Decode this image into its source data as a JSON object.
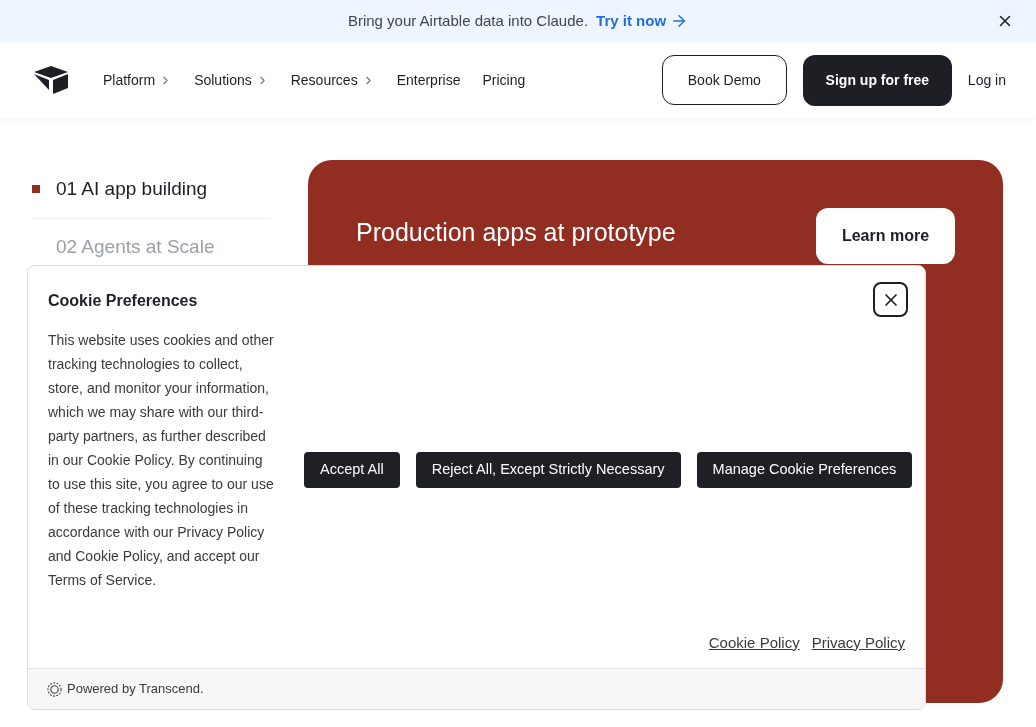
{
  "banner": {
    "text": "Bring your Airtable data into Claude.",
    "link": "Try it now"
  },
  "nav": {
    "items": [
      {
        "label": "Platform",
        "has_submenu": true
      },
      {
        "label": "Solutions",
        "has_submenu": true
      },
      {
        "label": "Resources",
        "has_submenu": true
      },
      {
        "label": "Enterprise",
        "has_submenu": false
      },
      {
        "label": "Pricing",
        "has_submenu": false
      }
    ],
    "book_demo": "Book Demo",
    "signup": "Sign up for free",
    "login": "Log in"
  },
  "sections": [
    {
      "label": "01 AI app building",
      "selected": true
    },
    {
      "label": "02 Agents at Scale",
      "selected": false
    }
  ],
  "feature_card": {
    "heading": "Production apps at prototype",
    "button": "Learn more"
  },
  "cookie_dialog": {
    "title": "Cookie Preferences",
    "body": "This website uses cookies and other tracking technologies to collect, store, and monitor your information, which we may share with our third-party partners, as further described in our Cookie Policy. By continuing to use this site, you agree to our use of these tracking technologies in accordance with our Privacy Policy and Cookie Policy, and accept our Terms of Service.",
    "buttons": [
      "Accept All",
      "Reject All, Except Strictly Necessary",
      "Manage Cookie Preferences"
    ],
    "links": [
      "Cookie Policy",
      "Privacy Policy"
    ],
    "footer": "Powered by Transcend."
  }
}
